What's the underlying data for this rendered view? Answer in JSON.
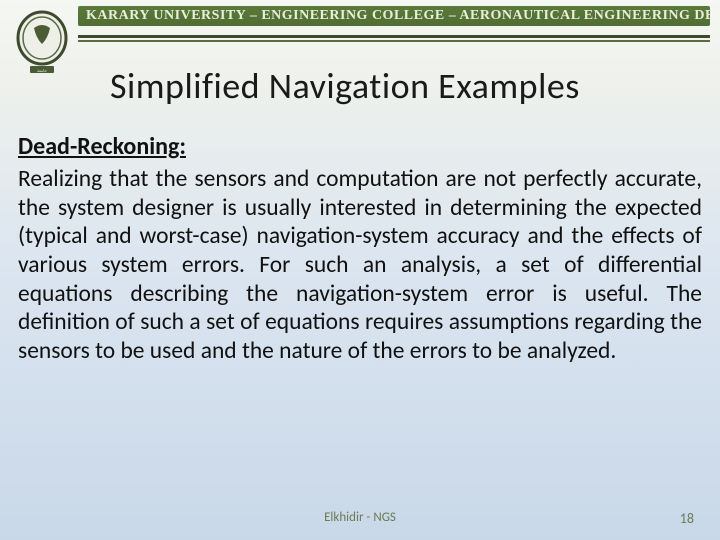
{
  "header": {
    "banner": "KARARY UNIVERSITY – ENGINEERING COLLEGE – AERONAUTICAL ENGINEERING DEPARTMENT",
    "logo_name": "university-crest"
  },
  "title": "Simplified Navigation Examples",
  "section": {
    "heading": "Dead-Reckoning:",
    "body": "Realizing that the sensors and computation are not perfectly accurate, the system designer is usually interested in determining the expected (typical and worst-case) navigation-system accuracy and the effects of various system errors. For such an analysis, a set of differential equations describing the navigation-system error is useful. The definition of such a set of equations requires assumptions regarding the sensors to be used and the nature of the errors to be analyzed."
  },
  "footer": {
    "center": "Elkhidir - NGS",
    "page": "18"
  }
}
